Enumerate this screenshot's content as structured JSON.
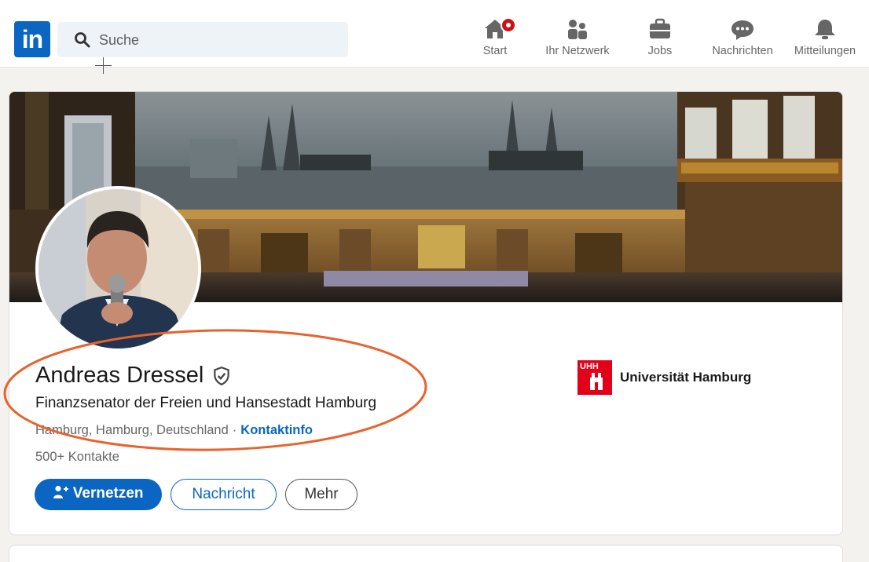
{
  "nav": {
    "logo_text": "in",
    "search_placeholder": "Suche",
    "items": [
      {
        "label": "Start",
        "icon": "home-icon"
      },
      {
        "label": "Ihr Netzwerk",
        "icon": "network-icon"
      },
      {
        "label": "Jobs",
        "icon": "briefcase-icon"
      },
      {
        "label": "Nachrichten",
        "icon": "messaging-icon"
      },
      {
        "label": "Mitteilungen",
        "icon": "bell-icon"
      }
    ]
  },
  "profile": {
    "name": "Andreas Dressel",
    "headline": "Finanzsenator der Freien und Hansestadt Hamburg",
    "location": "Hamburg, Hamburg, Deutschland",
    "separator": "·",
    "contact_info_link": "Kontaktinfo",
    "connections": "500+ Kontakte",
    "education": {
      "logo_text": "UHH",
      "name": "Universität Hamburg"
    }
  },
  "actions": {
    "connect": "Vernetzen",
    "message": "Nachricht",
    "more": "Mehr"
  },
  "colors": {
    "brand": "#0a66c2",
    "notification": "#cc1016",
    "highlight_ellipse": "#e8622c",
    "university": "#e2001a"
  }
}
